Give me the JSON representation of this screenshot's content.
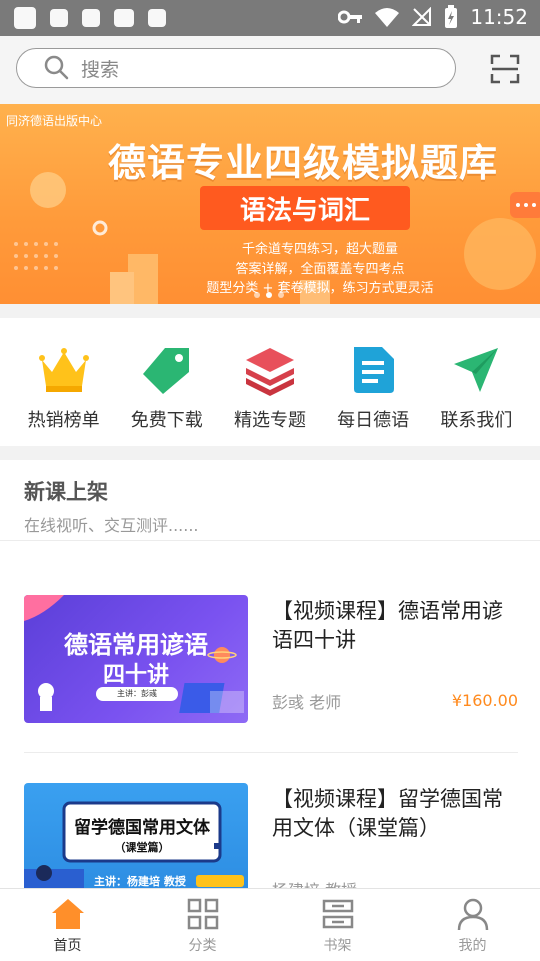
{
  "status": {
    "time": "11:52"
  },
  "search": {
    "placeholder": "搜索"
  },
  "banner": {
    "publisher": "同济德语出版中心",
    "title": "德语专业四级模拟题库",
    "subtitle": "语法与词汇",
    "line1": "千余道专四练习，超大题量",
    "line2": "答案详解，全面覆盖专四考点",
    "line3": "题型分类 + 套卷模拟，练习方式更灵活"
  },
  "quick": [
    {
      "label": "热销榜单",
      "icon": "crown-icon"
    },
    {
      "label": "免费下载",
      "icon": "tag-icon"
    },
    {
      "label": "精选专题",
      "icon": "layers-icon"
    },
    {
      "label": "每日德语",
      "icon": "document-icon"
    },
    {
      "label": "联系我们",
      "icon": "send-icon"
    }
  ],
  "section": {
    "title": "新课上架",
    "subtitle": "在线视听、交互测评......"
  },
  "courses": [
    {
      "title": "【视频课程】德语常用谚语四十讲",
      "thumb_title_1": "德语常用谚语",
      "thumb_title_2": "四十讲",
      "thumb_speaker": "主讲：彭彧",
      "teacher": "彭彧 老师",
      "price": "¥160.00"
    },
    {
      "title": "【视频课程】留学德国常用文体（课堂篇）",
      "thumb_title_1": "留学德国常用文体",
      "thumb_title_2": "（课堂篇）",
      "thumb_speaker": "主讲：杨建培 教授",
      "teacher": "杨建培 教授",
      "price": ""
    }
  ],
  "tabs": [
    {
      "label": "首页",
      "icon": "home-icon"
    },
    {
      "label": "分类",
      "icon": "grid-icon"
    },
    {
      "label": "书架",
      "icon": "bookshelf-icon"
    },
    {
      "label": "我的",
      "icon": "user-icon"
    }
  ],
  "colors": {
    "accent": "#ff8a1e",
    "home_active": "#ff8f2a"
  }
}
